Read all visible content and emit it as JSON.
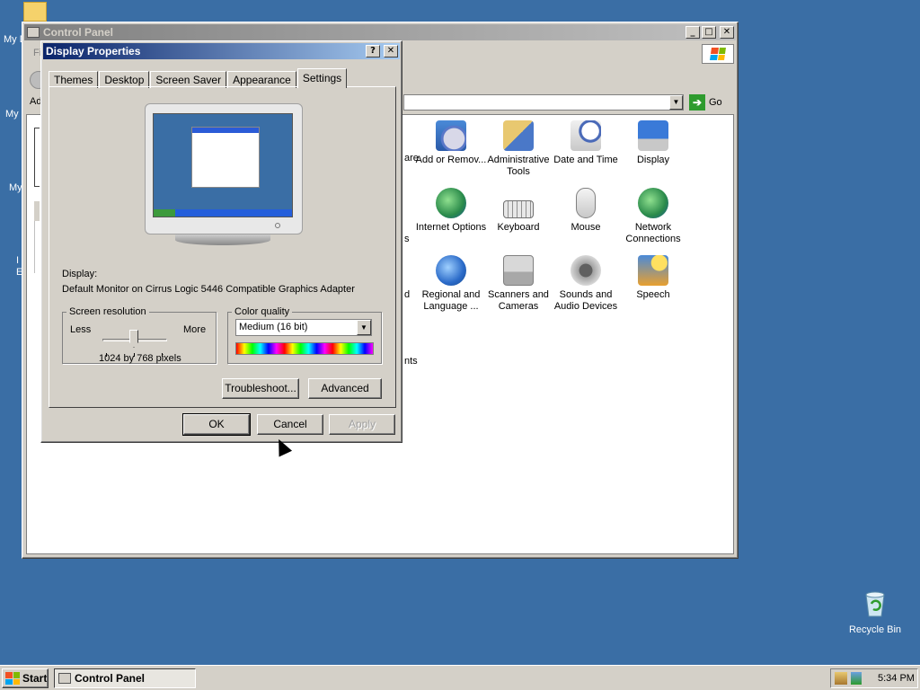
{
  "desktop": {
    "partial_labels": [
      "My D",
      "My",
      "My",
      "I",
      "E"
    ],
    "recycle_bin": "Recycle Bin"
  },
  "control_panel": {
    "title": "Control Panel",
    "menu_partial": "Fi",
    "address_partial": "Ad",
    "go": "Go",
    "partial_left_labels": [
      "are",
      "s",
      "d",
      "nts"
    ],
    "items": [
      {
        "label": "Add or Remov...",
        "icon": "add-remove-programs-icon"
      },
      {
        "label": "Administrative Tools",
        "icon": "administrative-tools-icon"
      },
      {
        "label": "Date and Time",
        "icon": "date-time-icon"
      },
      {
        "label": "Display",
        "icon": "display-icon"
      },
      {
        "label": "Internet Options",
        "icon": "internet-options-icon"
      },
      {
        "label": "Keyboard",
        "icon": "keyboard-icon"
      },
      {
        "label": "Mouse",
        "icon": "mouse-icon"
      },
      {
        "label": "Network Connections",
        "icon": "network-connections-icon"
      },
      {
        "label": "Regional and Language ...",
        "icon": "regional-language-icon"
      },
      {
        "label": "Scanners and Cameras",
        "icon": "scanners-cameras-icon"
      },
      {
        "label": "Sounds and Audio Devices",
        "icon": "sounds-audio-icon"
      },
      {
        "label": "Speech",
        "icon": "speech-icon"
      }
    ]
  },
  "display_properties": {
    "title": "Display Properties",
    "help_btn": "?",
    "close_btn": "✕",
    "tabs": [
      "Themes",
      "Desktop",
      "Screen Saver",
      "Appearance",
      "Settings"
    ],
    "selected_tab": "Settings",
    "display_label": "Display:",
    "display_value": "Default Monitor on Cirrus Logic 5446 Compatible Graphics Adapter",
    "resolution": {
      "legend": "Screen resolution",
      "less": "Less",
      "more": "More",
      "value": "1024 by 768 pixels"
    },
    "color_quality": {
      "legend": "Color quality",
      "selected": "Medium (16 bit)"
    },
    "buttons": {
      "troubleshoot": "Troubleshoot...",
      "advanced": "Advanced",
      "ok": "OK",
      "cancel": "Cancel",
      "apply": "Apply"
    }
  },
  "taskbar": {
    "start": "Start",
    "task": "Control Panel",
    "clock": "5:34 PM"
  }
}
